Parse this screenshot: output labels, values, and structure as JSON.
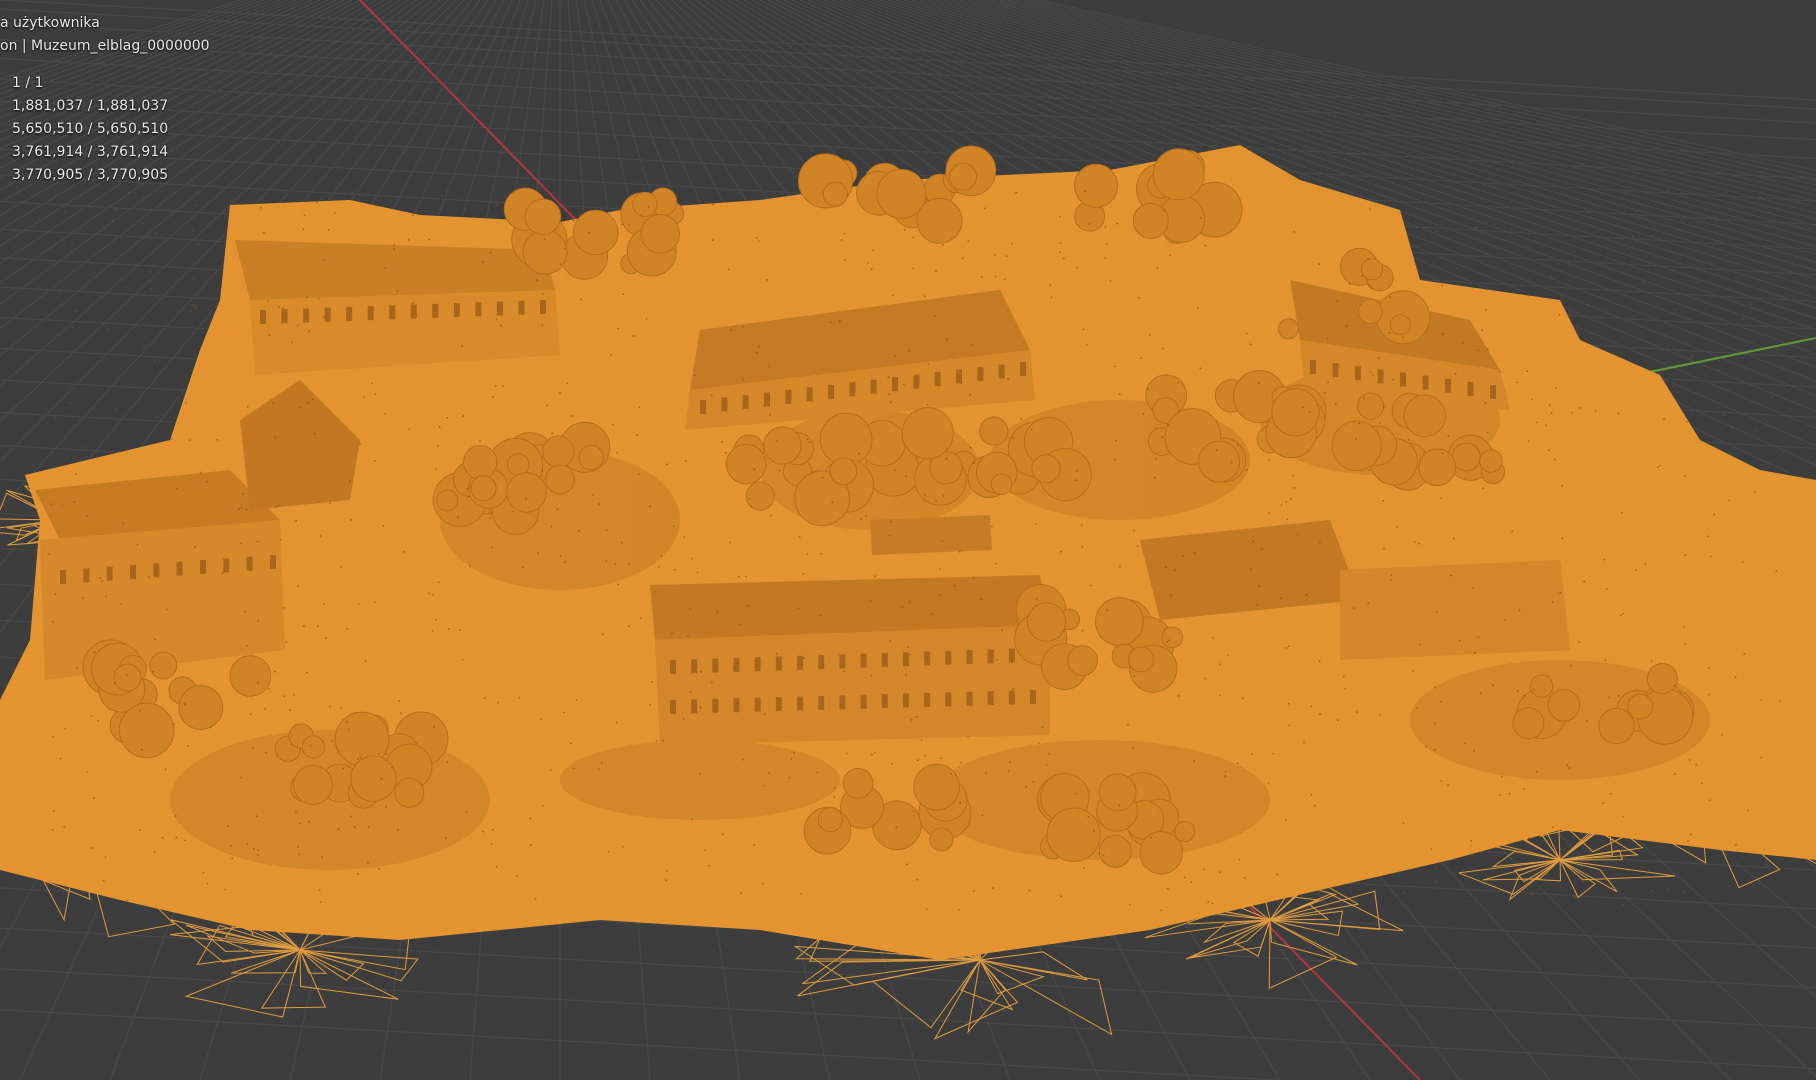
{
  "viewport": {
    "title_line": "a użytkownika",
    "object_line": "on | Muzeum_elblag_0000000",
    "stats": [
      "1 / 1",
      "1,881,037 / 1,881,037",
      "5,650,510 / 5,650,510",
      "3,761,914 / 3,761,914",
      "3,770,905 / 3,770,905"
    ]
  },
  "colors": {
    "background": "#3d3d3d",
    "grid_line": "#4a4a4a",
    "x_axis": "#b0353f",
    "y_axis": "#5e9b37",
    "mesh_fill": "#e3932f",
    "mesh_shadow": "#b86f1e",
    "mesh_wire": "#f0a640"
  },
  "icons": {
    "mesh": "mesh-object-icon"
  }
}
